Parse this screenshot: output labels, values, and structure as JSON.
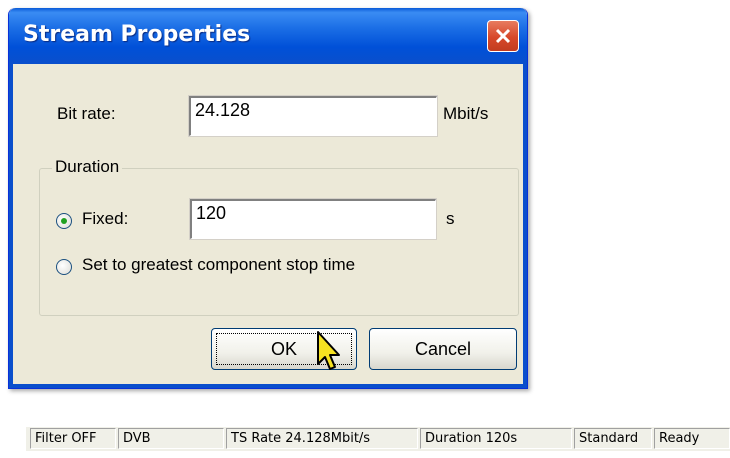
{
  "dialog": {
    "title": "Stream Properties",
    "bitrate_label": "Bit rate:",
    "bitrate_value": "24.128",
    "bitrate_unit": "Mbit/s",
    "duration_group": "Duration",
    "fixed_label": "Fixed:",
    "fixed_value": "120",
    "fixed_unit": "s",
    "greatest_label": "Set to greatest component stop time",
    "ok_label": "OK",
    "cancel_label": "Cancel"
  },
  "statusbar": {
    "panels": [
      "Filter OFF",
      "DVB",
      "TS Rate 24.128Mbit/s",
      "Duration 120s",
      "Standard",
      "Ready"
    ]
  }
}
